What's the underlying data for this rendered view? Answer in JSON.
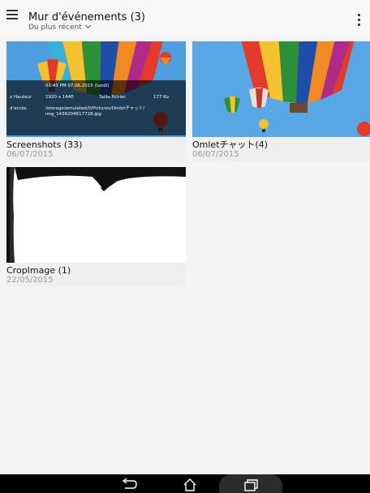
{
  "header": {
    "title": "Mur d'événements (3)",
    "sort_label": "Du plus récent"
  },
  "albums": [
    {
      "name": "Screenshots",
      "count": "(33)",
      "date": "06/07/2015",
      "overlay": {
        "datetime": "01:43 PM 07.06.2015 (lundi)",
        "dim_label": "x Hauteur",
        "dim_value": "1920 x 1440",
        "size_label": "Taille fichier",
        "size_value": "177 Ko",
        "path_label": "d'accès",
        "path_line1": "/storage/emulated/0/Pictures/Omletチャット/",
        "path_line2": "img_1436204617728.jpg"
      }
    },
    {
      "name": "Omletチャット",
      "count": "(4)",
      "date": "06/07/2015"
    },
    {
      "name": "CropImage",
      "count": "(1)",
      "date": "22/05/2015"
    }
  ],
  "navbar": {
    "icons": [
      "back-icon",
      "home-icon",
      "recent-apps-icon"
    ]
  },
  "colors": {
    "navbar": "#000000",
    "background": "#f4f4f4",
    "sky": "#4f9fe0",
    "date_text": "#9a9a9a"
  }
}
